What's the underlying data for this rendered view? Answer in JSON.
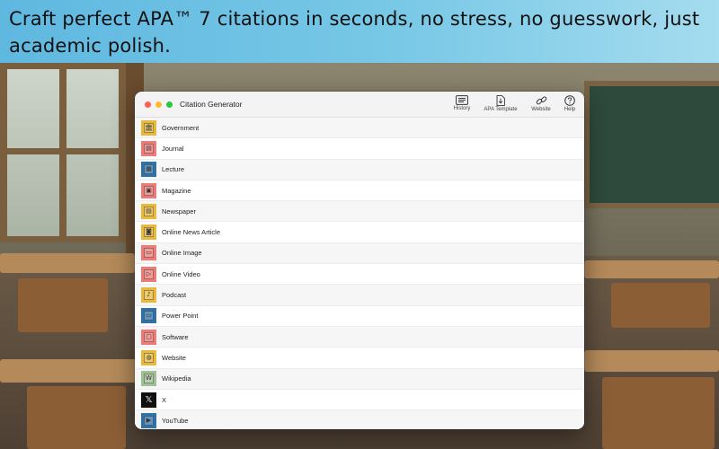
{
  "banner": {
    "text": "Craft perfect APA™ 7 citations in seconds, no stress, no guesswork, just academic polish."
  },
  "app": {
    "title": "Citation Generator",
    "toolbar": [
      {
        "label": "History",
        "icon": "history-icon"
      },
      {
        "label": "APA Template",
        "icon": "template-download-icon"
      },
      {
        "label": "Website",
        "icon": "link-icon"
      },
      {
        "label": "Help",
        "icon": "help-icon"
      }
    ],
    "items": [
      {
        "label": "Government",
        "icon": "government-icon",
        "color": "#e8b93a",
        "glyph": "🏛"
      },
      {
        "label": "Journal",
        "icon": "journal-icon",
        "color": "#ee7b76",
        "glyph": "▤"
      },
      {
        "label": "Lecture",
        "icon": "lecture-icon",
        "color": "#2f72a8",
        "glyph": "▦"
      },
      {
        "label": "Magazine",
        "icon": "magazine-icon",
        "color": "#ee7b76",
        "glyph": "▣"
      },
      {
        "label": "Newspaper",
        "icon": "newspaper-icon",
        "color": "#e8b93a",
        "glyph": "▤"
      },
      {
        "label": "Online News Article",
        "icon": "online-news-icon",
        "color": "#e8b93a",
        "glyph": "◙"
      },
      {
        "label": "Online Image",
        "icon": "online-image-icon",
        "color": "#ee7b76",
        "glyph": "▭"
      },
      {
        "label": "Online Video",
        "icon": "online-video-icon",
        "color": "#ee7b76",
        "glyph": "▷"
      },
      {
        "label": "Podcast",
        "icon": "podcast-icon",
        "color": "#e8b93a",
        "glyph": "♪"
      },
      {
        "label": "Power Point",
        "icon": "powerpoint-icon",
        "color": "#2f72a8",
        "glyph": "▭"
      },
      {
        "label": "Software",
        "icon": "software-icon",
        "color": "#ee7b76",
        "glyph": "▢"
      },
      {
        "label": "Website",
        "icon": "website-icon",
        "color": "#e8b93a",
        "glyph": "◍"
      },
      {
        "label": "Wikipedia",
        "icon": "wikipedia-icon",
        "color": "#9fbf96",
        "glyph": "W"
      },
      {
        "label": "X",
        "icon": "x-logo-icon",
        "color": "#111111",
        "glyph": "𝕏"
      },
      {
        "label": "YouTube",
        "icon": "youtube-icon",
        "color": "#2f72a8",
        "glyph": "▶"
      }
    ]
  }
}
